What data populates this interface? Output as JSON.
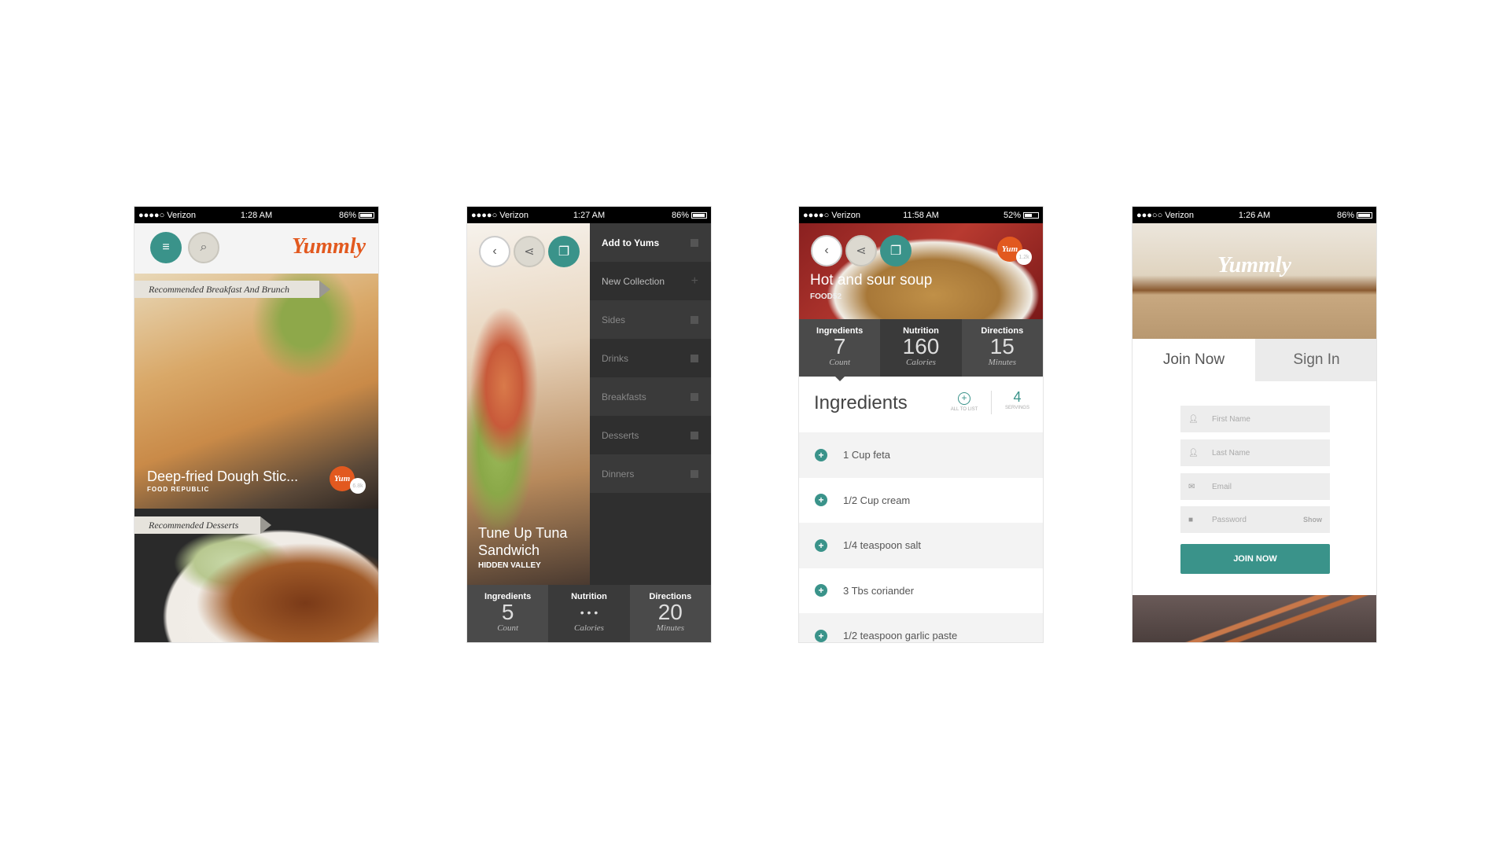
{
  "colors": {
    "teal": "#3a938a",
    "orange": "#e2591f",
    "dark": "#3a3a3a"
  },
  "logo": "Yummly",
  "logo_tm": "TM",
  "phone1": {
    "status": {
      "carrier": "●●●●○ Verizon",
      "time": "1:28 AM",
      "battery": "86%",
      "battery_level": 0.86
    },
    "icons": [
      "menu-icon",
      "search-icon"
    ],
    "section1": {
      "ribbon": "Recommended Breakfast And Brunch",
      "title": "Deep-fried Dough Stic...",
      "source": "FOOD REPUBLIC",
      "yum": "Yum",
      "yum_count": "6.8k"
    },
    "section2": {
      "ribbon": "Recommended Desserts"
    }
  },
  "phone2": {
    "status": {
      "carrier": "●●●●○ Verizon",
      "time": "1:27 AM",
      "battery": "86%",
      "battery_level": 0.86
    },
    "menu": [
      {
        "label": "Add to Yums",
        "icon": "checkbox"
      },
      {
        "label": "New Collection",
        "icon": "plus"
      },
      {
        "label": "Sides",
        "icon": "checkbox"
      },
      {
        "label": "Drinks",
        "icon": "checkbox"
      },
      {
        "label": "Breakfasts",
        "icon": "checkbox"
      },
      {
        "label": "Desserts",
        "icon": "checkbox"
      },
      {
        "label": "Dinners",
        "icon": "checkbox"
      }
    ],
    "title": "Tune Up Tuna Sandwich",
    "source": "HIDDEN VALLEY",
    "stats": [
      {
        "label": "Ingredients",
        "value": "5",
        "unit": "Count"
      },
      {
        "label": "Nutrition",
        "value": "• • •",
        "unit": "Calories"
      },
      {
        "label": "Directions",
        "value": "20",
        "unit": "Minutes"
      }
    ]
  },
  "phone3": {
    "status": {
      "carrier": "●●●●○ Verizon",
      "time": "11:58 AM",
      "battery": "52%",
      "battery_level": 0.52
    },
    "title": "Hot and sour soup",
    "source": "FOOD52",
    "yum": "Yum",
    "yum_count": "1.2k",
    "stats": [
      {
        "label": "Ingredients",
        "value": "7",
        "unit": "Count"
      },
      {
        "label": "Nutrition",
        "value": "160",
        "unit": "Calories"
      },
      {
        "label": "Directions",
        "value": "15",
        "unit": "Minutes"
      }
    ],
    "heading": "Ingredients",
    "all_to_list": "ALL TO LIST",
    "servings_value": "4",
    "servings_label": "SERVINGS",
    "ingredients": [
      "1 Cup feta",
      "1/2 Cup cream",
      "1/4 teaspoon salt",
      "3 Tbs coriander",
      "1/2 teaspoon garlic paste"
    ]
  },
  "phone4": {
    "status": {
      "carrier": "●●●○○ Verizon",
      "time": "1:26 AM",
      "battery": "86%",
      "battery_level": 0.86
    },
    "tabs": {
      "join": "Join Now",
      "signin": "Sign In"
    },
    "fields": {
      "first": "First Name",
      "last": "Last Name",
      "email": "Email",
      "password": "Password",
      "show": "Show"
    },
    "button": "JOIN NOW"
  }
}
